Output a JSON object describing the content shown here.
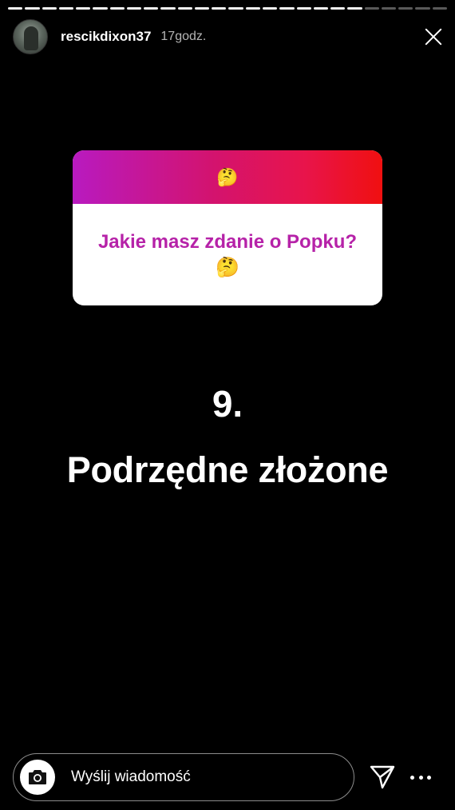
{
  "progress": {
    "total_segments": 26,
    "completed_segments": 21
  },
  "header": {
    "username": "rescikdixon37",
    "time": "17godz."
  },
  "sticker": {
    "emoji": "🤔",
    "question": "Jakie masz zdanie o Popku? 🤔",
    "gradient_colors": [
      "#b81ac0",
      "#d3136f",
      "#f01010"
    ]
  },
  "content": {
    "number": "9.",
    "title": "Podrzędne złożone"
  },
  "footer": {
    "message_placeholder": "Wyślij wiadomość"
  },
  "icons": {
    "camera": "camera-icon",
    "send": "send-icon",
    "more": "more-icon",
    "close": "close-icon"
  }
}
